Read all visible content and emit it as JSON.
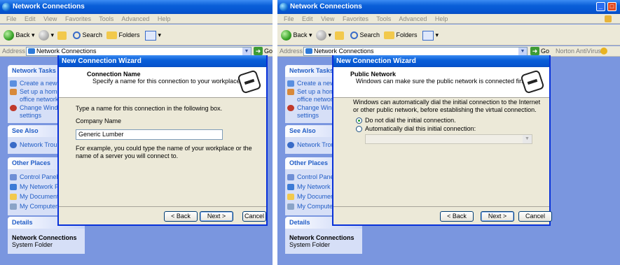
{
  "left": {
    "window_title": "Network Connections",
    "menu": [
      "File",
      "Edit",
      "View",
      "Favorites",
      "Tools",
      "Advanced",
      "Help"
    ],
    "toolbar": {
      "back": "Back",
      "search": "Search",
      "folders": "Folders"
    },
    "address": {
      "label": "Address",
      "value": "Network Connections",
      "go": "Go"
    },
    "sidebar": {
      "network_tasks": {
        "title": "Network Tasks",
        "items": [
          "Create a new c",
          "Set up a home",
          "office network",
          "Change Windo",
          "settings"
        ]
      },
      "see_also": {
        "title": "See Also",
        "items": [
          "Network Troub"
        ]
      },
      "other_places": {
        "title": "Other Places",
        "items": [
          "Control Panel",
          "My Network Pla",
          "My Documents",
          "My Computer"
        ]
      },
      "details": {
        "title": "Details",
        "name": "Network Connections",
        "type": "System Folder"
      }
    },
    "wizard": {
      "title": "New Connection Wizard",
      "header_title": "Connection Name",
      "header_subtitle": "Specify a name for this connection to your workplace.",
      "instruction": "Type a name for this connection in the following box.",
      "field_label": "Company Name",
      "field_value": "Generic Lumber",
      "example": "For example, you could type the name of your workplace or the name of a server you will connect to.",
      "back": "< Back",
      "next": "Next >",
      "cancel": "Cancel"
    }
  },
  "right": {
    "window_title": "Network Connections",
    "menu": [
      "File",
      "Edit",
      "View",
      "Favorites",
      "Tools",
      "Advanced",
      "Help"
    ],
    "toolbar": {
      "back": "Back",
      "search": "Search",
      "folders": "Folders"
    },
    "address": {
      "label": "Address",
      "value": "Network Connections",
      "go": "Go",
      "norton": "Norton AntiVirus"
    },
    "sidebar": {
      "network_tasks": {
        "title": "Network Tasks",
        "items": [
          "Create a new c",
          "Set up a home",
          "office network",
          "Change Windo",
          "settings"
        ]
      },
      "see_also": {
        "title": "See Also",
        "items": [
          "Network Troub"
        ]
      },
      "other_places": {
        "title": "Other Places",
        "items": [
          "Control Panel",
          "My Network Pla",
          "My Documents",
          "My Computer"
        ]
      },
      "details": {
        "title": "Details",
        "name": "Network Connections",
        "type": "System Folder"
      }
    },
    "wizard": {
      "title": "New Connection Wizard",
      "header_title": "Public Network",
      "header_subtitle": "Windows can make sure the public network is connected first.",
      "instruction": "Windows can automatically dial the initial connection to the Internet or other public network, before establishing the virtual connection.",
      "option_1": "Do not dial the initial connection.",
      "option_2": "Automatically dial this initial connection:",
      "option_1_selected": true,
      "back": "< Back",
      "next": "Next >",
      "cancel": "Cancel"
    }
  },
  "colors": {
    "titlebar": "#0554d0",
    "sidebar": "#7a96df",
    "dialog_face": "#ece9d8",
    "link": "#215dc6"
  }
}
